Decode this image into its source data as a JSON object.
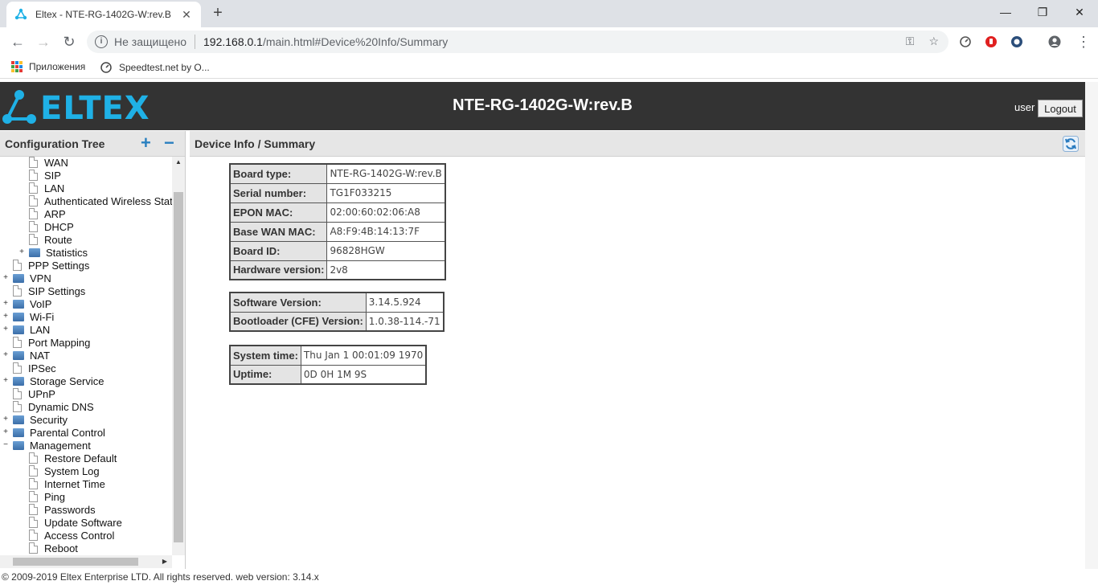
{
  "browser": {
    "tab_title": "Eltex - NTE-RG-1402G-W:rev.B",
    "new_tab_label": "+",
    "insecure_label": "Не защищено",
    "url_host": "192.168.0.1",
    "url_path": "/main.html#Device%20Info/Summary",
    "bookmarks": {
      "apps_label": "Приложения",
      "speedtest_label": "Speedtest.net by O..."
    }
  },
  "header": {
    "device_title": "NTE-RG-1402G-W:rev.B",
    "user_label": "user",
    "logout_label": "Logout",
    "brand_color": "#1fb1e6"
  },
  "left_panel": {
    "title": "Configuration Tree",
    "tree": [
      {
        "label": "WAN",
        "type": "doc",
        "level": 2
      },
      {
        "label": "SIP",
        "type": "doc",
        "level": 2
      },
      {
        "label": "LAN",
        "type": "doc",
        "level": 2
      },
      {
        "label": "Authenticated Wireless Stations",
        "type": "doc",
        "level": 2
      },
      {
        "label": "ARP",
        "type": "doc",
        "level": 2
      },
      {
        "label": "DHCP",
        "type": "doc",
        "level": 2
      },
      {
        "label": "Route",
        "type": "doc",
        "level": 2
      },
      {
        "label": "Statistics",
        "type": "folder",
        "level": 2,
        "toggle": "+"
      },
      {
        "label": "PPP Settings",
        "type": "doc",
        "level": 1
      },
      {
        "label": "VPN",
        "type": "folder",
        "level": 1,
        "toggle": "+"
      },
      {
        "label": "SIP Settings",
        "type": "doc",
        "level": 1
      },
      {
        "label": "VoIP",
        "type": "folder",
        "level": 1,
        "toggle": "+"
      },
      {
        "label": "Wi-Fi",
        "type": "folder",
        "level": 1,
        "toggle": "+"
      },
      {
        "label": "LAN",
        "type": "folder",
        "level": 1,
        "toggle": "+"
      },
      {
        "label": "Port Mapping",
        "type": "doc",
        "level": 1
      },
      {
        "label": "NAT",
        "type": "folder",
        "level": 1,
        "toggle": "+"
      },
      {
        "label": "IPSec",
        "type": "doc",
        "level": 1
      },
      {
        "label": "Storage Service",
        "type": "folder",
        "level": 1,
        "toggle": "+"
      },
      {
        "label": "UPnP",
        "type": "doc",
        "level": 1
      },
      {
        "label": "Dynamic DNS",
        "type": "doc",
        "level": 1
      },
      {
        "label": "Security",
        "type": "folder",
        "level": 1,
        "toggle": "+"
      },
      {
        "label": "Parental Control",
        "type": "folder",
        "level": 1,
        "toggle": "+"
      },
      {
        "label": "Management",
        "type": "folder",
        "level": 1,
        "toggle": "−"
      },
      {
        "label": "Restore Default",
        "type": "doc",
        "level": 2
      },
      {
        "label": "System Log",
        "type": "doc",
        "level": 2
      },
      {
        "label": "Internet Time",
        "type": "doc",
        "level": 2
      },
      {
        "label": "Ping",
        "type": "doc",
        "level": 2
      },
      {
        "label": "Passwords",
        "type": "doc",
        "level": 2
      },
      {
        "label": "Update Software",
        "type": "doc",
        "level": 2
      },
      {
        "label": "Access Control",
        "type": "doc",
        "level": 2
      },
      {
        "label": "Reboot",
        "type": "doc",
        "level": 2
      }
    ]
  },
  "main": {
    "title": "Device Info / Summary",
    "tables": [
      {
        "rows": [
          {
            "label": "Board type:",
            "value": "NTE-RG-1402G-W:rev.B"
          },
          {
            "label": "Serial number:",
            "value": "TG1F033215"
          },
          {
            "label": "EPON MAC:",
            "value": "02:00:60:02:06:A8"
          },
          {
            "label": "Base WAN MAC:",
            "value": "A8:F9:4B:14:13:7F"
          },
          {
            "label": "Board ID:",
            "value": "96828HGW"
          },
          {
            "label": "Hardware version:",
            "value": "2v8"
          }
        ]
      },
      {
        "rows": [
          {
            "label": "Software Version:",
            "value": "3.14.5.924"
          },
          {
            "label": "Bootloader (CFE) Version:",
            "value": "1.0.38-114.-71"
          }
        ]
      },
      {
        "rows": [
          {
            "label": "System time:",
            "value": "Thu Jan 1 00:01:09 1970"
          },
          {
            "label": "Uptime:",
            "value": "0D 0H 1M 9S"
          }
        ]
      }
    ]
  },
  "footer": {
    "text": "© 2009-2019 Eltex Enterprise LTD. All rights reserved. web version: 3.14.x"
  }
}
